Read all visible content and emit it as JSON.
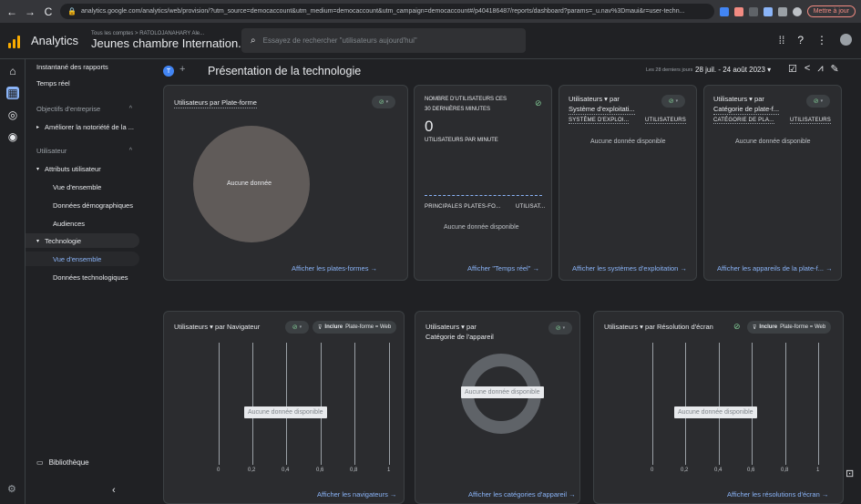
{
  "browser": {
    "url": "analytics.google.com/analytics/web/provision/?utm_source=democaccount&utm_medium=democaccount&utm_campaign=democaccount#/p404186487/reports/dashboard?params=_u.nav%3Dmaui&r=user-techn...",
    "update_button": "Mettre à jour"
  },
  "header": {
    "app_title": "Analytics",
    "account_path": "Tous les comptes > RATOLOJANAHARY Ale...",
    "property_name": "Jeunes chambre Internation...",
    "search_placeholder": "Essayez de rechercher \"utilisateurs aujourd'hui\""
  },
  "sidebar": {
    "snapshot": "Instantané des rapports",
    "realtime": "Temps réel",
    "objectives_section": "Objectifs d'entreprise",
    "awareness": "Améliorer la notoriété de la ...",
    "user_section": "Utilisateur",
    "user_attributes": "Attributs utilisateur",
    "overview1": "Vue d'ensemble",
    "demographics": "Données démographiques",
    "audiences": "Audiences",
    "technology": "Technologie",
    "overview2": "Vue d'ensemble",
    "tech_details": "Données technologiques",
    "library": "Bibliothèque"
  },
  "page": {
    "avatar_letter": "T",
    "title": "Présentation de la technologie",
    "date_label": "Les 28 derniers jours",
    "date_value": "28 juil. - 24 août 2023"
  },
  "cards": {
    "platform": {
      "title": "Utilisateurs par Plate-forme",
      "nodata": "Aucune donnée",
      "link": "Afficher les plates-formes →"
    },
    "realtime": {
      "title_line1": "NOMBRE D'UTILISATEURS CES",
      "title_line2": "30 DERNIÈRES MINUTES",
      "value": "0",
      "per_minute": "UTILISATEURS PAR MINUTE",
      "col1": "PRINCIPALES PLATES-FO...",
      "col2": "UTILISAT...",
      "nodata": "Aucune donnée disponible",
      "link": "Afficher \"Temps réel\" →"
    },
    "os": {
      "title_line1": "Utilisateurs ▾ par",
      "title_line2": "Système d'exploitati...",
      "col1": "SYSTÈME D'EXPLOI...",
      "col2": "UTILISATEURS",
      "nodata": "Aucune donnée disponible",
      "link": "Afficher les systèmes d'exploitation →"
    },
    "device_platform": {
      "title_line1": "Utilisateurs ▾ par",
      "title_line2": "Catégorie de plate-f...",
      "col1": "CATÉGORIE DE PLA...",
      "col2": "UTILISATEURS",
      "nodata": "Aucune donnée disponible",
      "link": "Afficher les appareils de la plate-f... →"
    },
    "browser": {
      "title": "Utilisateurs ▾ par Navigateur",
      "filter_label": "Inclure",
      "filter_value": "Plate-forme = Web",
      "nodata": "Aucune donnée disponible",
      "ticks": [
        "0",
        "0,2",
        "0,4",
        "0,6",
        "0,8",
        "1"
      ],
      "link": "Afficher les navigateurs →"
    },
    "device_category": {
      "title_line1": "Utilisateurs ▾ par",
      "title_line2": "Catégorie de l'appareil",
      "nodata": "Aucune donnée disponible",
      "link": "Afficher les catégories d'appareil →"
    },
    "resolution": {
      "title": "Utilisateurs ▾ par Résolution d'écran",
      "filter_label": "Inclure",
      "filter_value": "Plate-forme = Web",
      "nodata": "Aucune donnée disponible",
      "ticks": [
        "0",
        "0,2",
        "0,4",
        "0,6",
        "0,8",
        "1"
      ],
      "link": "Afficher les résolutions d'écran →"
    }
  }
}
